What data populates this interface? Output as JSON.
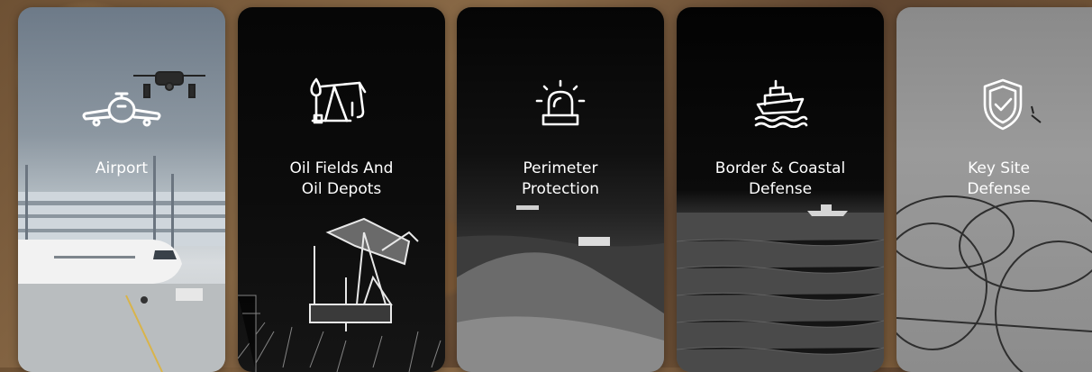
{
  "cards": [
    {
      "title": "Airport",
      "icon": "airplane-icon"
    },
    {
      "title": "Oil Fields And\nOil Depots",
      "icon": "oil-pump-icon"
    },
    {
      "title": "Perimeter\nProtection",
      "icon": "alarm-beacon-icon"
    },
    {
      "title": "Border & Coastal\nDefense",
      "icon": "ship-icon"
    },
    {
      "title": "Key Site\nDefense",
      "icon": "shield-check-icon"
    }
  ]
}
